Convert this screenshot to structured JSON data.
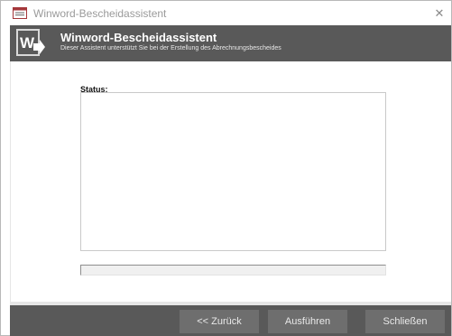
{
  "window": {
    "title": "Winword-Bescheidassistent",
    "close_glyph": "✕",
    "icon": "access-form-icon"
  },
  "header": {
    "title": "Winword-Bescheidassistent",
    "subtitle": "Dieser Assistent unterstützt Sie bei der Erstellung des Abrechnungsbescheides",
    "icon": "word-export-icon",
    "background": "#595959"
  },
  "main": {
    "status_label": "Status:",
    "status_text": "",
    "progress_fraction": 0
  },
  "footer": {
    "back_label": "<< Zurück",
    "run_label": "Ausführen",
    "close_label": "Schließen",
    "background": "#595959",
    "button_color": "#6e6e6e"
  }
}
